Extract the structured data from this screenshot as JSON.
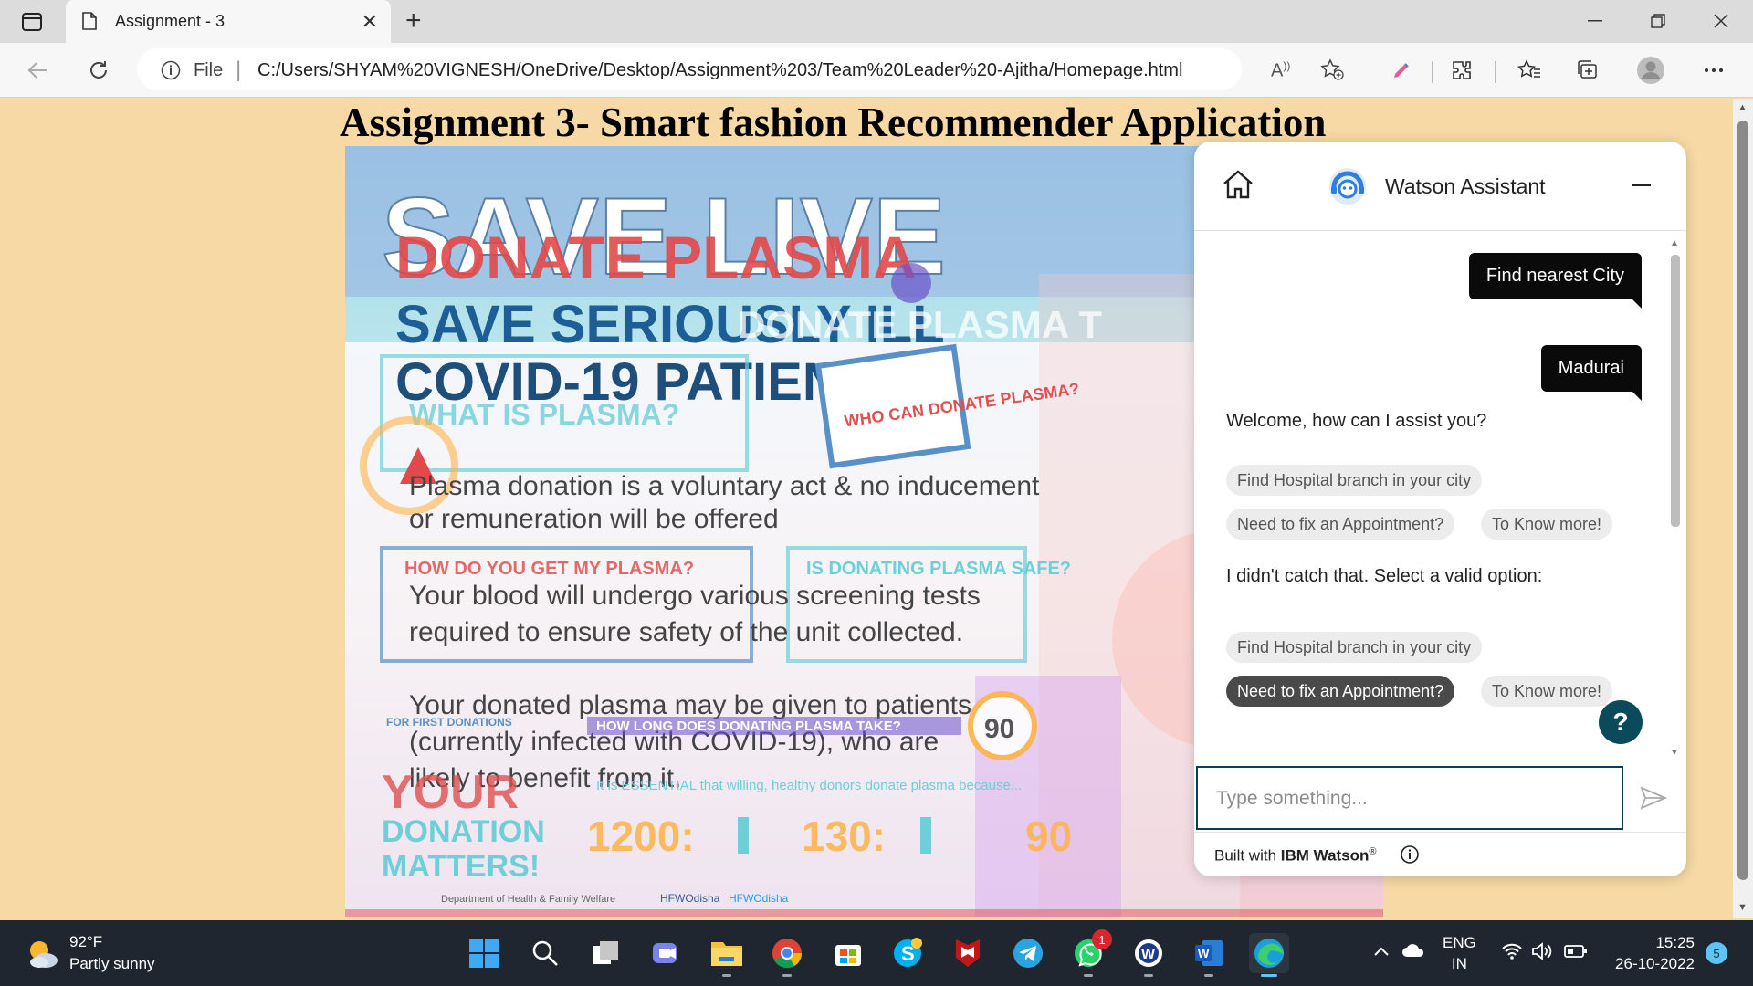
{
  "browser": {
    "tab_title": "Assignment - 3",
    "file_label": "File",
    "address": "C:/Users/SHYAM%20VIGNESH/OneDrive/Desktop/Assignment%203/Team%20Leader%20-Ajitha/Homepage.html"
  },
  "page": {
    "title": "Assignment 3- Smart fashion Recommender Application",
    "poster": {
      "line1": "SAVE LIVE",
      "line2": "DONATE PLASMA",
      "line3": "SAVE SERIOUSLY ILL",
      "line4": "COVID-19 PATIENTS!",
      "banner": "DONATE PLASMA T",
      "q1": "WHAT IS PLASMA?",
      "q2": "WHO CAN DONATE PLASMA?",
      "q3": "HOW DO YOU GET MY PLASMA?",
      "q4": "IS DONATING PLASMA SAFE?",
      "q5": "HOW LONG DOES DONATING PLASMA TAKE?",
      "bullet1a": "Plasma donation is a voluntary act & no inducement",
      "bullet1b": "or remuneration will be offered",
      "bullet2a": "Your blood will undergo various screening tests",
      "bullet2b": "required to ensure safety of the unit collected.",
      "bullet3a": "Your donated plasma may be given to patients",
      "bullet3b": "(currently infected with COVID-19), who are",
      "bullet3c": "likely to benefit from it.",
      "your": "YOUR",
      "donation": "DONATION",
      "matters": "MATTERS!",
      "essential": "It is ESSENTIAL that willing, healthy donors donate plasma because...",
      "stat1": "1200:",
      "stat2": "130:",
      "stat3": "90",
      "first": "FOR FIRST DONATIONS",
      "dept": "Department of Health & Family Welfare",
      "handle1": "HFWOdisha",
      "handle2": "HFWOdisha"
    }
  },
  "chat": {
    "title": "Watson Assistant",
    "messages": {
      "user1": "Find nearest City",
      "user2": "Madurai",
      "bot1": "Welcome, how can I assist you?",
      "bot2": "I didn't catch that. Select a valid option:"
    },
    "chips1": [
      "Find Hospital branch in your city",
      "Need to fix an Appointment?",
      "To Know more!"
    ],
    "chips2": [
      "Find Hospital branch in your city",
      "Need to fix an Appointment?",
      "To Know more!"
    ],
    "help": "?",
    "input_placeholder": "Type something...",
    "footer_prefix": "Built with",
    "footer_brand": "IBM Watson",
    "footer_reg": "®"
  },
  "taskbar": {
    "temperature": "92°F",
    "condition": "Partly sunny",
    "language": "ENG",
    "region": "IN",
    "time": "15:25",
    "date": "26-10-2022",
    "notification_count": "5",
    "whatsapp_badge": "1"
  },
  "colors": {
    "page_bg": "#f6d9a4",
    "chat_user_bubble": "#0a0a0a",
    "chat_selected_chip": "#4a4a4a",
    "help_button": "#0b4a5a",
    "input_border": "#0d3b5a",
    "taskbar": "#1f2630"
  },
  "icons": [
    "sidebar-icon",
    "document-icon",
    "close-icon",
    "plus-icon",
    "back-icon",
    "refresh-icon",
    "info-icon",
    "read-aloud-icon",
    "favorite-add-icon",
    "pen-icon",
    "extensions-icon",
    "favorites-icon",
    "collections-icon",
    "profile-icon",
    "more-icon",
    "home-icon",
    "watson-avatar-icon",
    "minimize-icon",
    "send-icon",
    "weather-icon",
    "windows-icon",
    "search-icon",
    "task-view-icon",
    "teams-icon",
    "file-explorer-icon",
    "chrome-icon",
    "store-icon",
    "skype-icon",
    "mcafee-icon",
    "telegram-icon",
    "whatsapp-icon",
    "app-icon",
    "word-icon",
    "edge-icon",
    "chevron-up-icon",
    "cloud-icon",
    "wifi-icon",
    "volume-icon",
    "battery-icon"
  ]
}
